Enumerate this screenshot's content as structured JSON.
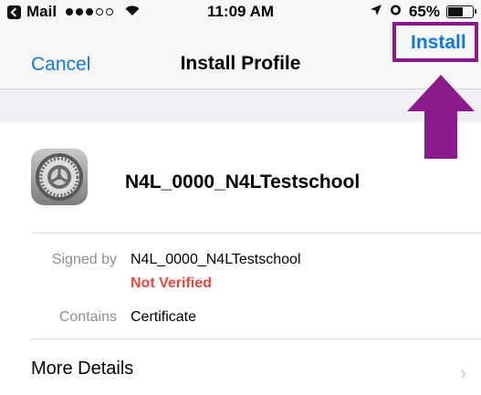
{
  "status_bar": {
    "carrier": "Mail",
    "time": "11:09 AM",
    "battery": "65%",
    "battery_level": 0.65
  },
  "nav": {
    "cancel": "Cancel",
    "title": "Install Profile",
    "install": "Install"
  },
  "profile": {
    "name": "N4L_0000_N4LTestschool",
    "icon": "settings-gear-icon"
  },
  "details": {
    "signed_by_label": "Signed by",
    "signed_by_value": "N4L_0000_N4LTestschool",
    "verification": "Not Verified",
    "contains_label": "Contains",
    "contains_value": "Certificate"
  },
  "more_details": "More Details",
  "colors": {
    "link": "#1478d6",
    "highlight": "#8b1a8c",
    "warning": "#e5483b"
  }
}
